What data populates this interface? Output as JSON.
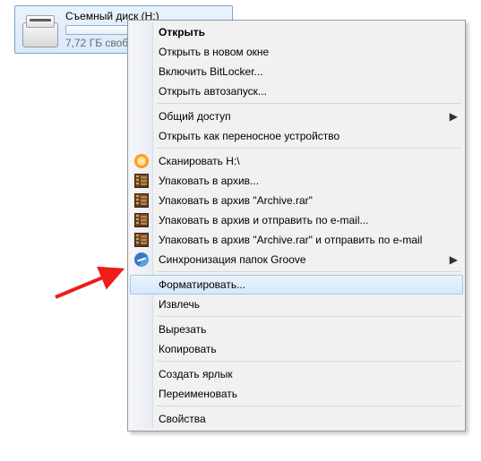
{
  "drive": {
    "title": "Съемный диск (H:)",
    "free_text": "7,72 ГБ своб"
  },
  "menu": {
    "open": "Открыть",
    "open_new_window": "Открыть в новом окне",
    "bitlocker": "Включить BitLocker...",
    "autoplay": "Открыть автозапуск...",
    "sharing": "Общий доступ",
    "portable_device": "Открыть как переносное устройство",
    "scan": "Сканировать H:\\",
    "rar_pack": "Упаковать в архив...",
    "rar_pack_named": "Упаковать в архив \"Archive.rar\"",
    "rar_pack_mail": "Упаковать в архив и отправить по e-mail...",
    "rar_pack_named_mail": "Упаковать в архив \"Archive.rar\" и отправить по e-mail",
    "groove_sync": "Синхронизация папок Groove",
    "format": "Форматировать...",
    "eject": "Извлечь",
    "cut": "Вырезать",
    "copy": "Копировать",
    "create_shortcut": "Создать ярлык",
    "rename": "Переименовать",
    "properties": "Свойства"
  }
}
